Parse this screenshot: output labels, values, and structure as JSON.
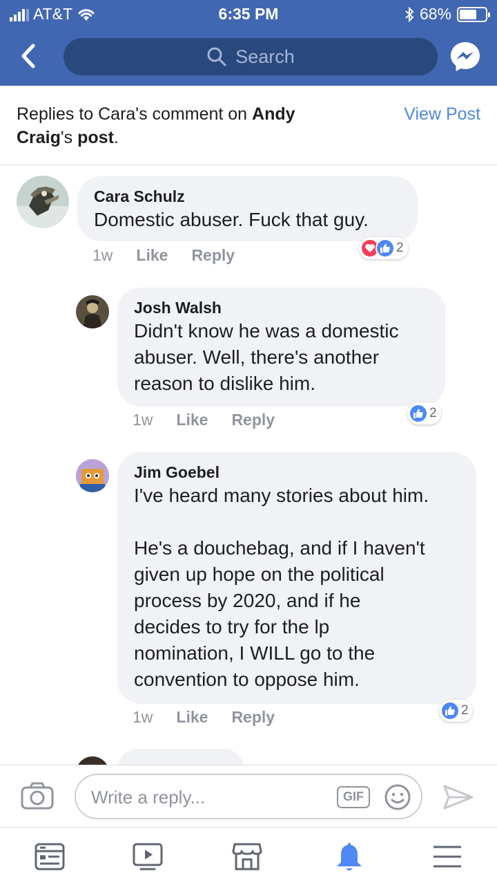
{
  "status_bar": {
    "carrier": "AT&T",
    "time": "6:35 PM",
    "battery": "68%",
    "battery_level": 0.68
  },
  "nav": {
    "back_icon": "chevron-left-icon",
    "search_placeholder": "Search",
    "messenger_icon": "messenger-icon"
  },
  "context": {
    "prefix": "Replies to Cara's comment on ",
    "author_first": "Andy",
    "author_second": "Craig",
    "possessive": "'s ",
    "post_word": "post",
    "period": ".",
    "view_post": "View Post"
  },
  "comments": [
    {
      "name": "Cara Schulz",
      "text": "Domestic abuser. Fuck that guy.",
      "time": "1w",
      "like": "Like",
      "reply": "Reply",
      "reaction_count": "2",
      "reactions": [
        "love",
        "like"
      ]
    },
    {
      "name": "Josh Walsh",
      "text": "Didn't know he was a domestic\nabuser. Well, there's another\nreason to dislike him.",
      "time": "1w",
      "like": "Like",
      "reply": "Reply",
      "reaction_count": "2",
      "reactions": [
        "like"
      ]
    },
    {
      "name": "Jim Goebel",
      "text": "I've heard many stories about him.\n\nHe's a douchebag, and if I haven't\ngiven up hope on the political\nprocess by 2020, and if he\ndecides to try for the lp\nnomination, I WILL go to the\nconvention to oppose him.",
      "time": "1w",
      "like": "Like",
      "reply": "Reply",
      "reaction_count": "2",
      "reactions": [
        "like"
      ]
    }
  ],
  "composer": {
    "placeholder": "Write a reply...",
    "gif_label": "GIF"
  },
  "tabs": [
    {
      "icon": "news-feed-icon",
      "active": false
    },
    {
      "icon": "watch-video-icon",
      "active": false
    },
    {
      "icon": "marketplace-icon",
      "active": false
    },
    {
      "icon": "notifications-bell-icon",
      "active": true
    },
    {
      "icon": "menu-icon",
      "active": false
    }
  ],
  "colors": {
    "brand_blue": "#4267b2",
    "link_blue": "#4e88dc",
    "active_tab": "#4e88f2",
    "bubble": "#f0f2f5"
  }
}
